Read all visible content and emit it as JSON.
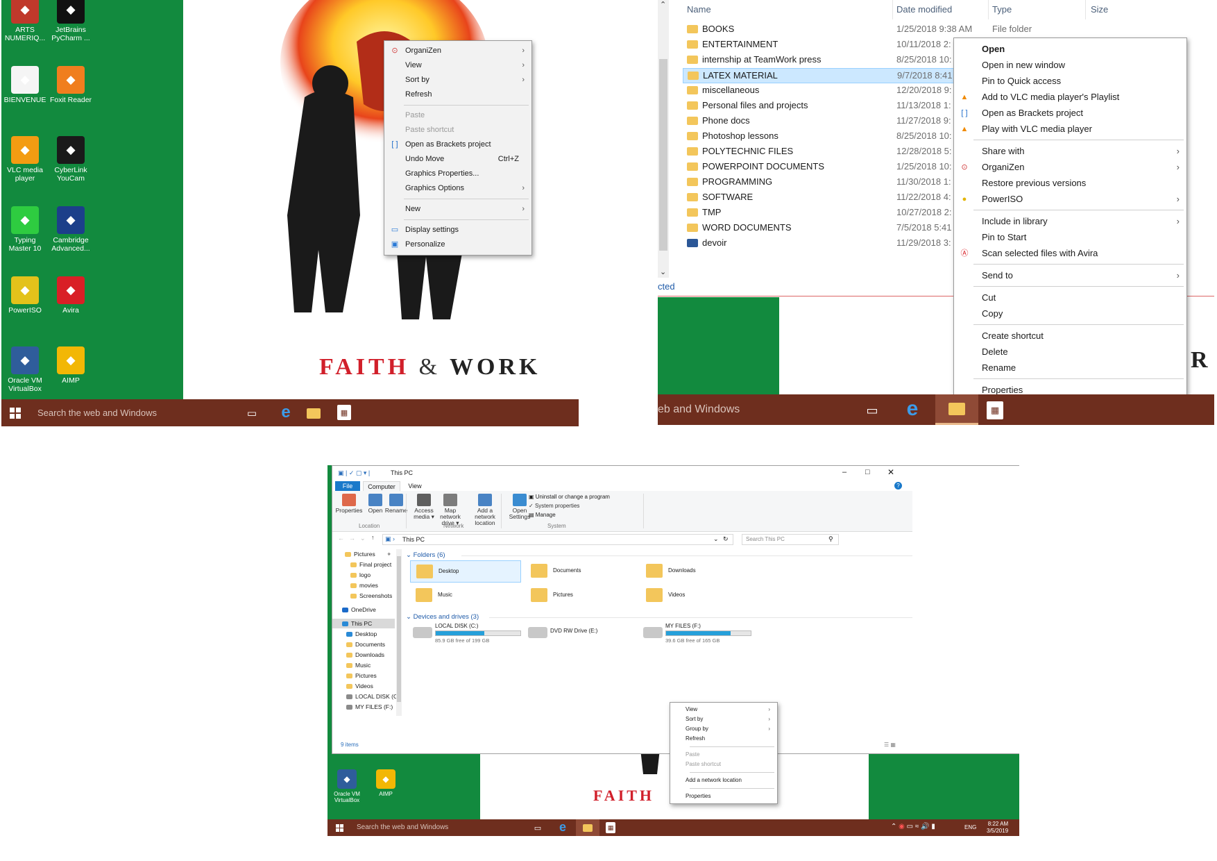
{
  "panel1": {
    "desktop_icons": [
      {
        "label": "ARTS NUMERIQ...",
        "icon": "arts-numeriq-icon",
        "color": "#c0392b"
      },
      {
        "label": "JetBrains PyCharm ...",
        "icon": "pycharm-icon",
        "color": "#111111"
      },
      {
        "label": "BIENVENUE",
        "icon": "document-icon",
        "color": "#f5f5f5"
      },
      {
        "label": "Foxit Reader",
        "icon": "foxit-reader-icon",
        "color": "#f07e1e"
      },
      {
        "label": "VLC media player",
        "icon": "vlc-icon",
        "color": "#f39c12"
      },
      {
        "label": "CyberLink YouCam",
        "icon": "youcam-icon",
        "color": "#1a1a1a"
      },
      {
        "label": "Typing Master 10",
        "icon": "typing-master-icon",
        "color": "#2ecc40"
      },
      {
        "label": "Cambridge Advanced...",
        "icon": "cambridge-icon",
        "color": "#1c3f8a"
      },
      {
        "label": "PowerISO",
        "icon": "poweriso-icon",
        "color": "#e3c21b"
      },
      {
        "label": "Avira",
        "icon": "avira-icon",
        "color": "#d91f26"
      },
      {
        "label": "Oracle VM VirtualBox",
        "icon": "virtualbox-icon",
        "color": "#2f5d9b"
      },
      {
        "label": "AIMP",
        "icon": "aimp-icon",
        "color": "#f2b705"
      }
    ],
    "wallpaper_title_left": "FAITH",
    "wallpaper_title_amp": "&",
    "wallpaper_title_right": "WORK",
    "context_menu": [
      {
        "label": "OrganiZen",
        "icon": "organizen-icon",
        "arrow": true
      },
      {
        "label": "View",
        "arrow": true
      },
      {
        "label": "Sort by",
        "arrow": true
      },
      {
        "label": "Refresh"
      },
      {
        "sep": true
      },
      {
        "label": "Paste",
        "disabled": true
      },
      {
        "label": "Paste shortcut",
        "disabled": true
      },
      {
        "label": "Open as Brackets project",
        "icon": "brackets-icon"
      },
      {
        "label": "Undo Move",
        "shortcut": "Ctrl+Z"
      },
      {
        "label": "Graphics Properties..."
      },
      {
        "label": "Graphics Options",
        "arrow": true
      },
      {
        "sep": true
      },
      {
        "label": "New",
        "arrow": true
      },
      {
        "sep": true
      },
      {
        "label": "Display settings",
        "icon": "display-settings-icon"
      },
      {
        "label": "Personalize",
        "icon": "personalize-icon"
      }
    ],
    "taskbar_search": "Search the web and Windows"
  },
  "panel2": {
    "columns": {
      "name": "Name",
      "date": "Date modified",
      "type": "Type",
      "size": "Size"
    },
    "rows": [
      {
        "name": "BOOKS",
        "date": "1/25/2018 9:38 AM",
        "type": "File folder",
        "icon": "folder-icon"
      },
      {
        "name": "ENTERTAINMENT",
        "date": "10/11/2018 2:",
        "type": "",
        "icon": "folder-icon"
      },
      {
        "name": "internship at TeamWork press",
        "date": "8/25/2018 10:",
        "type": "",
        "icon": "folder-icon"
      },
      {
        "name": "LATEX MATERIAL",
        "date": "9/7/2018 8:41",
        "type": "",
        "icon": "folder-icon",
        "selected": true
      },
      {
        "name": "miscellaneous",
        "date": "12/20/2018 9:",
        "type": "",
        "icon": "folder-icon"
      },
      {
        "name": "Personal files  and projects",
        "date": "11/13/2018 1:",
        "type": "",
        "icon": "folder-icon"
      },
      {
        "name": "Phone docs",
        "date": "11/27/2018 9:",
        "type": "",
        "icon": "folder-icon"
      },
      {
        "name": "Photoshop lessons",
        "date": "8/25/2018 10:",
        "type": "",
        "icon": "folder-icon"
      },
      {
        "name": "POLYTECHNIC FILES",
        "date": "12/28/2018 5:",
        "type": "",
        "icon": "folder-icon"
      },
      {
        "name": "POWERPOINT DOCUMENTS",
        "date": "1/25/2018 10:",
        "type": "",
        "icon": "folder-icon"
      },
      {
        "name": "PROGRAMMING",
        "date": "11/30/2018 1:",
        "type": "",
        "icon": "folder-icon"
      },
      {
        "name": "SOFTWARE",
        "date": "11/22/2018 4:",
        "type": "",
        "icon": "folder-icon"
      },
      {
        "name": "TMP",
        "date": "10/27/2018 2:",
        "type": "",
        "icon": "folder-icon"
      },
      {
        "name": "WORD DOCUMENTS",
        "date": "7/5/2018 5:41",
        "type": "",
        "icon": "folder-icon"
      },
      {
        "name": "devoir",
        "date": "11/29/2018 3:",
        "type": "",
        "icon": "word-doc-icon"
      }
    ],
    "status_fragment": "cted",
    "context_menu": [
      {
        "label": "Open",
        "bold": true
      },
      {
        "label": "Open in new window"
      },
      {
        "label": "Pin to Quick access"
      },
      {
        "label": "Add to VLC media player's Playlist",
        "icon": "vlc-icon"
      },
      {
        "label": "Open as Brackets project",
        "icon": "brackets-icon"
      },
      {
        "label": "Play with VLC media player",
        "icon": "vlc-icon"
      },
      {
        "sep": true
      },
      {
        "label": "Share with",
        "arrow": true
      },
      {
        "label": "OrganiZen",
        "icon": "organizen-icon",
        "arrow": true
      },
      {
        "label": "Restore previous versions"
      },
      {
        "label": "PowerISO",
        "icon": "poweriso-icon",
        "arrow": true
      },
      {
        "sep": true
      },
      {
        "label": "Include in library",
        "arrow": true
      },
      {
        "label": "Pin to Start"
      },
      {
        "label": "Scan selected files with Avira",
        "icon": "avira-icon"
      },
      {
        "sep": true
      },
      {
        "label": "Send to",
        "arrow": true
      },
      {
        "sep": true
      },
      {
        "label": "Cut"
      },
      {
        "label": "Copy"
      },
      {
        "sep": true
      },
      {
        "label": "Create shortcut"
      },
      {
        "label": "Delete"
      },
      {
        "label": "Rename"
      },
      {
        "sep": true
      },
      {
        "label": "Properties"
      }
    ],
    "wallpaper_letter": "R",
    "taskbar_search": "eb and Windows"
  },
  "panel3": {
    "title": "This PC",
    "ribbon_tabs": [
      "File",
      "Computer",
      "View"
    ],
    "ribbon_buttons": [
      {
        "label": "Properties",
        "icon": "properties-icon"
      },
      {
        "label": "Open",
        "icon": "open-icon"
      },
      {
        "label": "Rename",
        "icon": "rename-icon"
      },
      {
        "label": "Access media ▾",
        "icon": "access-media-icon"
      },
      {
        "label": "Map network drive ▾",
        "icon": "map-network-drive-icon"
      },
      {
        "label": "Add a network location",
        "icon": "add-network-location-icon"
      },
      {
        "label": "Open Settings",
        "icon": "settings-icon"
      }
    ],
    "ribbon_small": [
      "Uninstall or change a program",
      "System properties",
      "Manage"
    ],
    "ribbon_groups": [
      "Location",
      "Network",
      "System"
    ],
    "address": "This PC",
    "search_placeholder": "Search This PC",
    "nav": [
      {
        "label": "Pictures",
        "icon": "pictures-icon",
        "pin": true
      },
      {
        "label": "Final project",
        "icon": "folder-icon"
      },
      {
        "label": "logo",
        "icon": "folder-icon"
      },
      {
        "label": "movies",
        "icon": "folder-icon"
      },
      {
        "label": "Screenshots",
        "icon": "folder-icon"
      },
      {
        "label": "OneDrive",
        "icon": "onedrive-icon"
      },
      {
        "label": "This PC",
        "icon": "this-pc-icon",
        "selected": true
      },
      {
        "label": "Desktop",
        "icon": "desktop-icon"
      },
      {
        "label": "Documents",
        "icon": "documents-icon"
      },
      {
        "label": "Downloads",
        "icon": "downloads-icon"
      },
      {
        "label": "Music",
        "icon": "music-icon"
      },
      {
        "label": "Pictures",
        "icon": "pictures-icon"
      },
      {
        "label": "Videos",
        "icon": "videos-icon"
      },
      {
        "label": "LOCAL DISK (C:)",
        "icon": "drive-icon"
      },
      {
        "label": "MY FILES (F:)",
        "icon": "drive-icon"
      }
    ],
    "folders_header": "Folders (6)",
    "folders": [
      "Desktop",
      "Documents",
      "Downloads",
      "Music",
      "Pictures",
      "Videos"
    ],
    "devices_header": "Devices and drives (3)",
    "drives": [
      {
        "name": "LOCAL DISK (C:)",
        "free": "85.9 GB free of 199 GB",
        "used": 0.57,
        "icon": "windows-drive-icon"
      },
      {
        "name": "DVD RW Drive (E:)",
        "free": "",
        "used": null,
        "icon": "dvd-drive-icon"
      },
      {
        "name": "MY FILES (F:)",
        "free": "39.6 GB free of 165 GB",
        "used": 0.76,
        "icon": "drive-icon"
      }
    ],
    "status": "9 items",
    "context_menu": [
      {
        "label": "View",
        "arrow": true
      },
      {
        "label": "Sort by",
        "arrow": true
      },
      {
        "label": "Group by",
        "arrow": true
      },
      {
        "label": "Refresh"
      },
      {
        "sep": true
      },
      {
        "label": "Paste",
        "disabled": true
      },
      {
        "label": "Paste shortcut",
        "disabled": true
      },
      {
        "sep": true
      },
      {
        "label": "Add a network location"
      },
      {
        "sep": true
      },
      {
        "label": "Properties"
      }
    ],
    "desktop_icons": [
      {
        "label": "Oracle VM VirtualBox",
        "icon": "virtualbox-icon",
        "color": "#2f5d9b"
      },
      {
        "label": "AIMP",
        "icon": "aimp-icon",
        "color": "#f2b705"
      }
    ],
    "wallpaper_title": "FAITH",
    "taskbar_search": "Search the web and Windows",
    "tray_lang": "ENG",
    "clock_time": "8:22 AM",
    "clock_date": "3/5/2019"
  }
}
